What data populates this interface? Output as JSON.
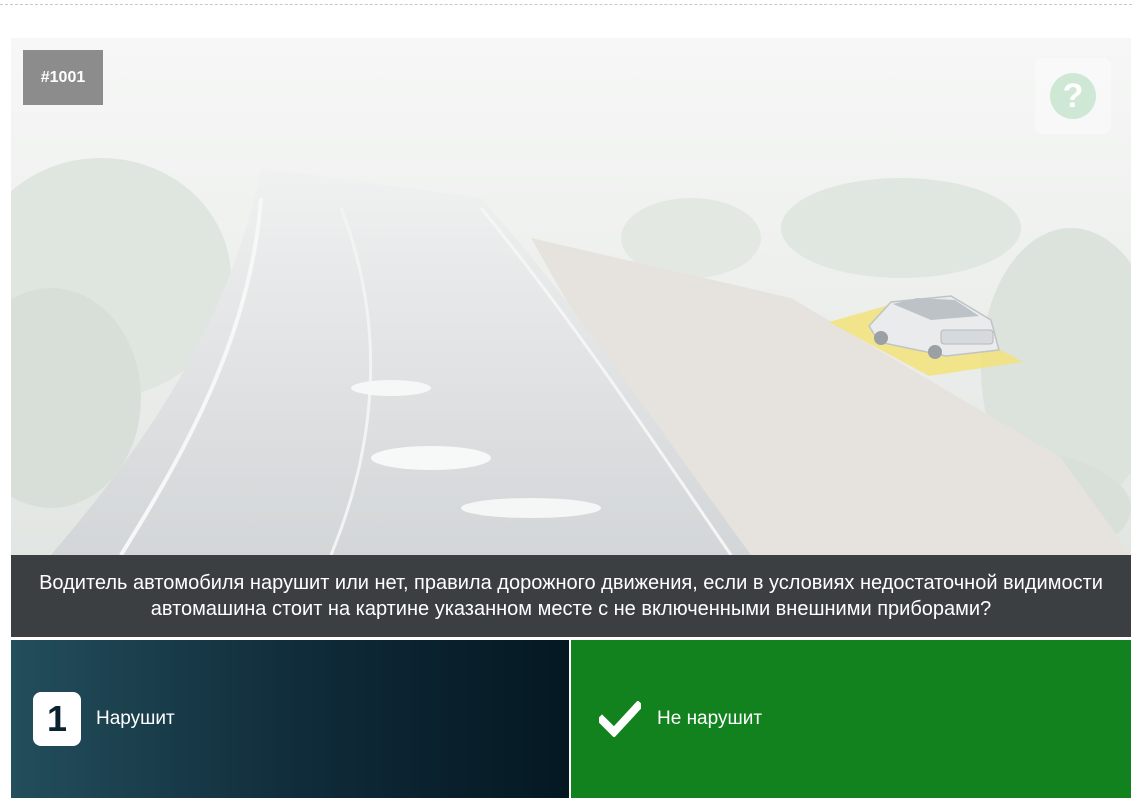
{
  "question": {
    "id_badge": "#1001",
    "text": "Водитель автомобиля нарушит или нет, правила дорожного движения, если в условиях недостаточной видимости автомашина стоит на картине указанном месте с не включенными внешними приборами?",
    "help_icon": "question-circle-icon",
    "help_glyph": "?"
  },
  "answers": [
    {
      "number": "1",
      "label": "Нарушит",
      "selected": false
    },
    {
      "label": "Не нарушит",
      "icon": "checkmark-icon",
      "correct": true,
      "color": "#12821f"
    }
  ],
  "colors": {
    "question_bar": "#3b3f42",
    "answer_correct": "#12821f",
    "answer_default_dark": "#041822"
  }
}
